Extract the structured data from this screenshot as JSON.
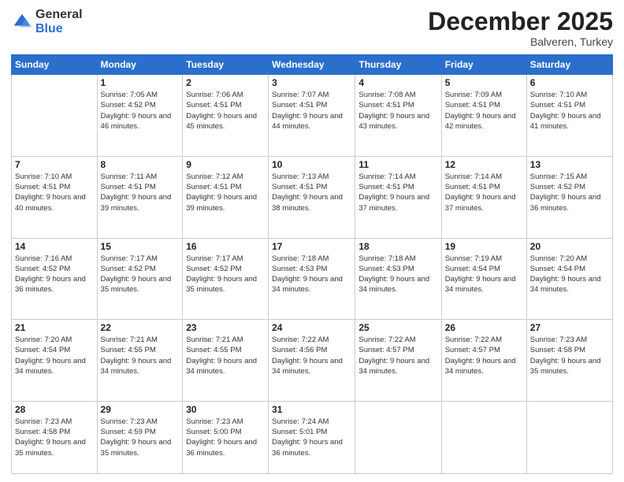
{
  "logo": {
    "general": "General",
    "blue": "Blue"
  },
  "header": {
    "month": "December 2025",
    "location": "Balveren, Turkey"
  },
  "days_of_week": [
    "Sunday",
    "Monday",
    "Tuesday",
    "Wednesday",
    "Thursday",
    "Friday",
    "Saturday"
  ],
  "weeks": [
    [
      {
        "num": "",
        "sunrise": "",
        "sunset": "",
        "daylight": ""
      },
      {
        "num": "1",
        "sunrise": "Sunrise: 7:05 AM",
        "sunset": "Sunset: 4:52 PM",
        "daylight": "Daylight: 9 hours and 46 minutes."
      },
      {
        "num": "2",
        "sunrise": "Sunrise: 7:06 AM",
        "sunset": "Sunset: 4:51 PM",
        "daylight": "Daylight: 9 hours and 45 minutes."
      },
      {
        "num": "3",
        "sunrise": "Sunrise: 7:07 AM",
        "sunset": "Sunset: 4:51 PM",
        "daylight": "Daylight: 9 hours and 44 minutes."
      },
      {
        "num": "4",
        "sunrise": "Sunrise: 7:08 AM",
        "sunset": "Sunset: 4:51 PM",
        "daylight": "Daylight: 9 hours and 43 minutes."
      },
      {
        "num": "5",
        "sunrise": "Sunrise: 7:09 AM",
        "sunset": "Sunset: 4:51 PM",
        "daylight": "Daylight: 9 hours and 42 minutes."
      },
      {
        "num": "6",
        "sunrise": "Sunrise: 7:10 AM",
        "sunset": "Sunset: 4:51 PM",
        "daylight": "Daylight: 9 hours and 41 minutes."
      }
    ],
    [
      {
        "num": "7",
        "sunrise": "Sunrise: 7:10 AM",
        "sunset": "Sunset: 4:51 PM",
        "daylight": "Daylight: 9 hours and 40 minutes."
      },
      {
        "num": "8",
        "sunrise": "Sunrise: 7:11 AM",
        "sunset": "Sunset: 4:51 PM",
        "daylight": "Daylight: 9 hours and 39 minutes."
      },
      {
        "num": "9",
        "sunrise": "Sunrise: 7:12 AM",
        "sunset": "Sunset: 4:51 PM",
        "daylight": "Daylight: 9 hours and 39 minutes."
      },
      {
        "num": "10",
        "sunrise": "Sunrise: 7:13 AM",
        "sunset": "Sunset: 4:51 PM",
        "daylight": "Daylight: 9 hours and 38 minutes."
      },
      {
        "num": "11",
        "sunrise": "Sunrise: 7:14 AM",
        "sunset": "Sunset: 4:51 PM",
        "daylight": "Daylight: 9 hours and 37 minutes."
      },
      {
        "num": "12",
        "sunrise": "Sunrise: 7:14 AM",
        "sunset": "Sunset: 4:51 PM",
        "daylight": "Daylight: 9 hours and 37 minutes."
      },
      {
        "num": "13",
        "sunrise": "Sunrise: 7:15 AM",
        "sunset": "Sunset: 4:52 PM",
        "daylight": "Daylight: 9 hours and 36 minutes."
      }
    ],
    [
      {
        "num": "14",
        "sunrise": "Sunrise: 7:16 AM",
        "sunset": "Sunset: 4:52 PM",
        "daylight": "Daylight: 9 hours and 36 minutes."
      },
      {
        "num": "15",
        "sunrise": "Sunrise: 7:17 AM",
        "sunset": "Sunset: 4:52 PM",
        "daylight": "Daylight: 9 hours and 35 minutes."
      },
      {
        "num": "16",
        "sunrise": "Sunrise: 7:17 AM",
        "sunset": "Sunset: 4:52 PM",
        "daylight": "Daylight: 9 hours and 35 minutes."
      },
      {
        "num": "17",
        "sunrise": "Sunrise: 7:18 AM",
        "sunset": "Sunset: 4:53 PM",
        "daylight": "Daylight: 9 hours and 34 minutes."
      },
      {
        "num": "18",
        "sunrise": "Sunrise: 7:18 AM",
        "sunset": "Sunset: 4:53 PM",
        "daylight": "Daylight: 9 hours and 34 minutes."
      },
      {
        "num": "19",
        "sunrise": "Sunrise: 7:19 AM",
        "sunset": "Sunset: 4:54 PM",
        "daylight": "Daylight: 9 hours and 34 minutes."
      },
      {
        "num": "20",
        "sunrise": "Sunrise: 7:20 AM",
        "sunset": "Sunset: 4:54 PM",
        "daylight": "Daylight: 9 hours and 34 minutes."
      }
    ],
    [
      {
        "num": "21",
        "sunrise": "Sunrise: 7:20 AM",
        "sunset": "Sunset: 4:54 PM",
        "daylight": "Daylight: 9 hours and 34 minutes."
      },
      {
        "num": "22",
        "sunrise": "Sunrise: 7:21 AM",
        "sunset": "Sunset: 4:55 PM",
        "daylight": "Daylight: 9 hours and 34 minutes."
      },
      {
        "num": "23",
        "sunrise": "Sunrise: 7:21 AM",
        "sunset": "Sunset: 4:55 PM",
        "daylight": "Daylight: 9 hours and 34 minutes."
      },
      {
        "num": "24",
        "sunrise": "Sunrise: 7:22 AM",
        "sunset": "Sunset: 4:56 PM",
        "daylight": "Daylight: 9 hours and 34 minutes."
      },
      {
        "num": "25",
        "sunrise": "Sunrise: 7:22 AM",
        "sunset": "Sunset: 4:57 PM",
        "daylight": "Daylight: 9 hours and 34 minutes."
      },
      {
        "num": "26",
        "sunrise": "Sunrise: 7:22 AM",
        "sunset": "Sunset: 4:57 PM",
        "daylight": "Daylight: 9 hours and 34 minutes."
      },
      {
        "num": "27",
        "sunrise": "Sunrise: 7:23 AM",
        "sunset": "Sunset: 4:58 PM",
        "daylight": "Daylight: 9 hours and 35 minutes."
      }
    ],
    [
      {
        "num": "28",
        "sunrise": "Sunrise: 7:23 AM",
        "sunset": "Sunset: 4:58 PM",
        "daylight": "Daylight: 9 hours and 35 minutes."
      },
      {
        "num": "29",
        "sunrise": "Sunrise: 7:23 AM",
        "sunset": "Sunset: 4:59 PM",
        "daylight": "Daylight: 9 hours and 35 minutes."
      },
      {
        "num": "30",
        "sunrise": "Sunrise: 7:23 AM",
        "sunset": "Sunset: 5:00 PM",
        "daylight": "Daylight: 9 hours and 36 minutes."
      },
      {
        "num": "31",
        "sunrise": "Sunrise: 7:24 AM",
        "sunset": "Sunset: 5:01 PM",
        "daylight": "Daylight: 9 hours and 36 minutes."
      },
      {
        "num": "",
        "sunrise": "",
        "sunset": "",
        "daylight": ""
      },
      {
        "num": "",
        "sunrise": "",
        "sunset": "",
        "daylight": ""
      },
      {
        "num": "",
        "sunrise": "",
        "sunset": "",
        "daylight": ""
      }
    ]
  ]
}
